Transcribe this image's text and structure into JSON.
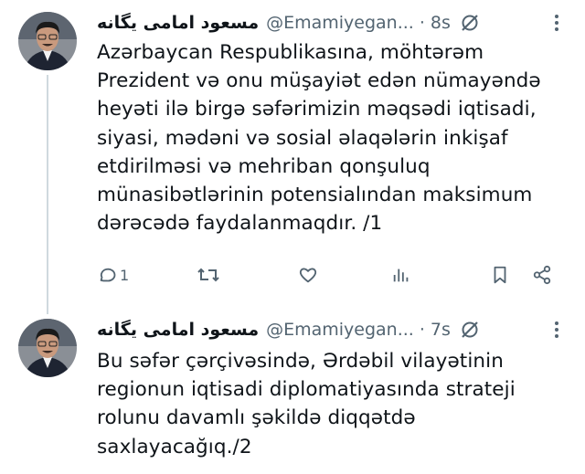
{
  "tweets": [
    {
      "display_name": "مسعود امامی یگانه",
      "handle": "@Emamiyegan...",
      "time": "· 8s",
      "text": "Azərbaycan Respublikasına, möhtərəm\nPrezident və onu müşayiət edən nümayəndə\nheyəti ilə birgə səfərimizin məqsədi iqtisadi,\nsiyasi, mədəni və sosial əlaqələrin inkişaf\netdirilməsi və mehriban qonşuluq\nmünasibətlərinin potensialından maksimum\ndərəcədə faydalanmaqdır. /1",
      "actions": {
        "reply_icon": "reply-icon",
        "reply_count": "1",
        "retweet_icon": "retweet-icon",
        "like_icon": "like-icon",
        "views_icon": "views-icon",
        "bookmark_icon": "bookmark-icon",
        "share_icon": "share-icon"
      }
    },
    {
      "display_name": "مسعود امامی یگانه",
      "handle": "@Emamiyegan...",
      "time": "· 7s",
      "text": "Bu səfər çərçivəsində, Ərdəbil vilayətinin\nregionun iqtisadi diplomatiyasında strateji\nrolunu davamlı şəkildə diqqətdə\nsaxlayacağıq./2"
    }
  ],
  "colors": {
    "text": "#0f1419",
    "secondary": "#536471",
    "thread_line": "#cfd9de",
    "background": "#ffffff"
  }
}
